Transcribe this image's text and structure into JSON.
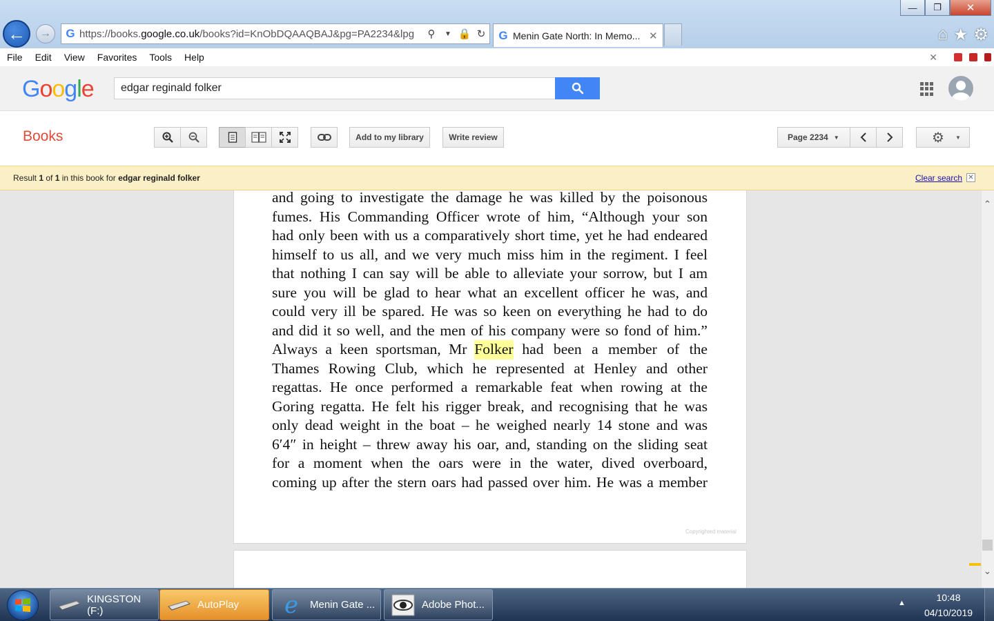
{
  "browser": {
    "url_prefix": "https://books.",
    "url_domain": "google.co.uk",
    "url_rest": "/books?id=KnObDQAAQBAJ&pg=PA2234&lpg",
    "tab_title": "Menin Gate North: In Memo...",
    "window_controls": {
      "minimize": "—",
      "restore": "❐",
      "close": "✕"
    }
  },
  "menubar": {
    "items": [
      "File",
      "Edit",
      "View",
      "Favorites",
      "Tools",
      "Help"
    ],
    "close_glyph": "✕"
  },
  "google": {
    "logo": [
      "G",
      "o",
      "o",
      "g",
      "l",
      "e"
    ],
    "logo_colors": [
      "#4285f4",
      "#ea4335",
      "#fbbc05",
      "#4285f4",
      "#34a853",
      "#ea4335"
    ],
    "search_value": "edgar reginald folker"
  },
  "books_toolbar": {
    "section_label": "Books",
    "add_library": "Add to my library",
    "write_review": "Write review",
    "page_label": "Page 2234"
  },
  "result_bar": {
    "prefix": "Result ",
    "current": "1",
    "of": " of ",
    "total": "1",
    "middle": " in this book for ",
    "query": "edgar reginald folker",
    "clear_label": "Clear search"
  },
  "book_page": {
    "lines": [
      "and going to investigate the damage he was killed by the poisonous",
      "fumes. His Commanding Officer wrote of him, “Although your son",
      "had only been with us a comparatively short time, yet he had endeared",
      "himself to us all, and we very much miss him in the regiment. I feel",
      "that nothing I can say will be able to alleviate your sorrow, but I am",
      "sure you will be glad to hear what an excellent officer he was, and",
      "could very ill be spared. He was so keen on everything he had to do",
      "and did it so well, and the men of his company were so fond of him.”",
      "Always a keen sportsman, Mr ",
      "Thames Rowing Club, which he represented at Henley and other",
      "regattas. He once performed a remarkable feat when rowing at the",
      "Goring regatta. He felt his rigger break, and recognising that he was",
      "only dead weight in the boat – he weighed nearly 14 stone and was",
      "6′4″ in height – threw away his oar, and, standing on the sliding seat",
      "for a moment when the oars were in the water, dived overboard,",
      "coming up after the stern oars had passed over him. He was a member"
    ],
    "highlight_word": "Folker",
    "line9_after": " had been a member of the",
    "copyright": "Copyrighted material"
  },
  "taskbar": {
    "items": [
      {
        "label": "KINGSTON (F:)",
        "icon": "usb-drive-icon"
      },
      {
        "label": "AutoPlay",
        "icon": "autoplay-drive-icon"
      },
      {
        "label": "Menin Gate ...",
        "icon": "internet-explorer-icon"
      },
      {
        "label": "Adobe Phot...",
        "icon": "photoshop-eye-icon"
      }
    ],
    "time": "10:48",
    "date": "04/10/2019"
  },
  "colors": {
    "accent": "#4285f4",
    "books_red": "#dd4b39",
    "highlight": "#ffff99",
    "result_bar": "#fbf0c5"
  }
}
